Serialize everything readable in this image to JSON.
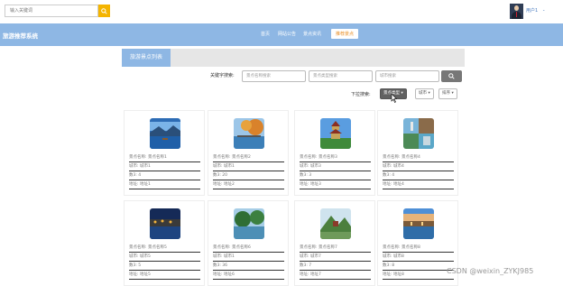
{
  "header": {
    "search_placeholder": "输入关键词",
    "username": "用户1"
  },
  "nav": {
    "system_name": "旅游推荐系统",
    "items": [
      "首页",
      "网站公告",
      "景点资讯",
      "推荐景点"
    ],
    "active_index": 3
  },
  "section": {
    "title": "旅游景点列表"
  },
  "filters": {
    "keyword_label": "关键字搜索:",
    "placeholders": [
      "景点名称搜索",
      "景点类型搜索",
      "城市搜索"
    ],
    "dropdown_label": "下拉搜索:",
    "dropdowns": [
      "景点类型",
      "城市",
      "排序"
    ]
  },
  "cards": [
    {
      "name": "景点名称: 景点名称1",
      "city": "城市: 城市1",
      "views": "数3: 4",
      "address": "地址: 地址1"
    },
    {
      "name": "景点名称: 景点名称2",
      "city": "城市: 城市1",
      "views": "数3: 20",
      "address": "地址: 地址2"
    },
    {
      "name": "景点名称: 景点名称3",
      "city": "城市: 城市3",
      "views": "数3: 3",
      "address": "地址: 地址3"
    },
    {
      "name": "景点名称: 景点名称4",
      "city": "城市: 城市4",
      "views": "数3: 4",
      "address": "地址: 地址4"
    },
    {
      "name": "景点名称: 景点名称5",
      "city": "城市: 城市5",
      "views": "数3: 5",
      "address": "地址: 地址5"
    },
    {
      "name": "景点名称: 景点名称6",
      "city": "城市: 城市1",
      "views": "数3: 36",
      "address": "地址: 地址6"
    },
    {
      "name": "景点名称: 景点名称7",
      "city": "城市: 城市7",
      "views": "数3: 7",
      "address": "地址: 地址7"
    },
    {
      "name": "景点名称: 景点名称8",
      "city": "城市: 城市8",
      "views": "数3: 8",
      "address": "地址: 地址8"
    }
  ],
  "watermark": "CSDN @weixin_ZYKJ985",
  "colors": {
    "nav": "#8eb7e4",
    "search_button": "#f4b400",
    "active_nav": "#e9922c"
  }
}
